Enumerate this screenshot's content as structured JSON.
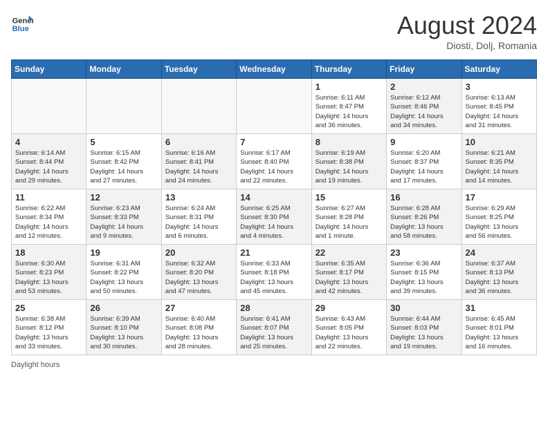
{
  "header": {
    "logo_text_general": "General",
    "logo_text_blue": "Blue",
    "month_title": "August 2024",
    "subtitle": "Diosti, Dolj, Romania"
  },
  "days_of_week": [
    "Sunday",
    "Monday",
    "Tuesday",
    "Wednesday",
    "Thursday",
    "Friday",
    "Saturday"
  ],
  "weeks": [
    [
      {
        "day": "",
        "info": "",
        "empty": true
      },
      {
        "day": "",
        "info": "",
        "empty": true
      },
      {
        "day": "",
        "info": "",
        "empty": true
      },
      {
        "day": "",
        "info": "",
        "empty": true
      },
      {
        "day": "1",
        "info": "Sunrise: 6:11 AM\nSunset: 8:47 PM\nDaylight: 14 hours\nand 36 minutes."
      },
      {
        "day": "2",
        "info": "Sunrise: 6:12 AM\nSunset: 8:46 PM\nDaylight: 14 hours\nand 34 minutes."
      },
      {
        "day": "3",
        "info": "Sunrise: 6:13 AM\nSunset: 8:45 PM\nDaylight: 14 hours\nand 31 minutes."
      }
    ],
    [
      {
        "day": "4",
        "info": "Sunrise: 6:14 AM\nSunset: 8:44 PM\nDaylight: 14 hours\nand 29 minutes."
      },
      {
        "day": "5",
        "info": "Sunrise: 6:15 AM\nSunset: 8:42 PM\nDaylight: 14 hours\nand 27 minutes."
      },
      {
        "day": "6",
        "info": "Sunrise: 6:16 AM\nSunset: 8:41 PM\nDaylight: 14 hours\nand 24 minutes."
      },
      {
        "day": "7",
        "info": "Sunrise: 6:17 AM\nSunset: 8:40 PM\nDaylight: 14 hours\nand 22 minutes."
      },
      {
        "day": "8",
        "info": "Sunrise: 6:19 AM\nSunset: 8:38 PM\nDaylight: 14 hours\nand 19 minutes."
      },
      {
        "day": "9",
        "info": "Sunrise: 6:20 AM\nSunset: 8:37 PM\nDaylight: 14 hours\nand 17 minutes."
      },
      {
        "day": "10",
        "info": "Sunrise: 6:21 AM\nSunset: 8:35 PM\nDaylight: 14 hours\nand 14 minutes."
      }
    ],
    [
      {
        "day": "11",
        "info": "Sunrise: 6:22 AM\nSunset: 8:34 PM\nDaylight: 14 hours\nand 12 minutes."
      },
      {
        "day": "12",
        "info": "Sunrise: 6:23 AM\nSunset: 8:33 PM\nDaylight: 14 hours\nand 9 minutes."
      },
      {
        "day": "13",
        "info": "Sunrise: 6:24 AM\nSunset: 8:31 PM\nDaylight: 14 hours\nand 6 minutes."
      },
      {
        "day": "14",
        "info": "Sunrise: 6:25 AM\nSunset: 8:30 PM\nDaylight: 14 hours\nand 4 minutes."
      },
      {
        "day": "15",
        "info": "Sunrise: 6:27 AM\nSunset: 8:28 PM\nDaylight: 14 hours\nand 1 minute."
      },
      {
        "day": "16",
        "info": "Sunrise: 6:28 AM\nSunset: 8:26 PM\nDaylight: 13 hours\nand 58 minutes."
      },
      {
        "day": "17",
        "info": "Sunrise: 6:29 AM\nSunset: 8:25 PM\nDaylight: 13 hours\nand 56 minutes."
      }
    ],
    [
      {
        "day": "18",
        "info": "Sunrise: 6:30 AM\nSunset: 8:23 PM\nDaylight: 13 hours\nand 53 minutes."
      },
      {
        "day": "19",
        "info": "Sunrise: 6:31 AM\nSunset: 8:22 PM\nDaylight: 13 hours\nand 50 minutes."
      },
      {
        "day": "20",
        "info": "Sunrise: 6:32 AM\nSunset: 8:20 PM\nDaylight: 13 hours\nand 47 minutes."
      },
      {
        "day": "21",
        "info": "Sunrise: 6:33 AM\nSunset: 8:18 PM\nDaylight: 13 hours\nand 45 minutes."
      },
      {
        "day": "22",
        "info": "Sunrise: 6:35 AM\nSunset: 8:17 PM\nDaylight: 13 hours\nand 42 minutes."
      },
      {
        "day": "23",
        "info": "Sunrise: 6:36 AM\nSunset: 8:15 PM\nDaylight: 13 hours\nand 39 minutes."
      },
      {
        "day": "24",
        "info": "Sunrise: 6:37 AM\nSunset: 8:13 PM\nDaylight: 13 hours\nand 36 minutes."
      }
    ],
    [
      {
        "day": "25",
        "info": "Sunrise: 6:38 AM\nSunset: 8:12 PM\nDaylight: 13 hours\nand 33 minutes."
      },
      {
        "day": "26",
        "info": "Sunrise: 6:39 AM\nSunset: 8:10 PM\nDaylight: 13 hours\nand 30 minutes."
      },
      {
        "day": "27",
        "info": "Sunrise: 6:40 AM\nSunset: 8:08 PM\nDaylight: 13 hours\nand 28 minutes."
      },
      {
        "day": "28",
        "info": "Sunrise: 6:41 AM\nSunset: 8:07 PM\nDaylight: 13 hours\nand 25 minutes."
      },
      {
        "day": "29",
        "info": "Sunrise: 6:43 AM\nSunset: 8:05 PM\nDaylight: 13 hours\nand 22 minutes."
      },
      {
        "day": "30",
        "info": "Sunrise: 6:44 AM\nSunset: 8:03 PM\nDaylight: 13 hours\nand 19 minutes."
      },
      {
        "day": "31",
        "info": "Sunrise: 6:45 AM\nSunset: 8:01 PM\nDaylight: 13 hours\nand 16 minutes."
      }
    ]
  ],
  "footer": {
    "text": "Daylight hours"
  }
}
